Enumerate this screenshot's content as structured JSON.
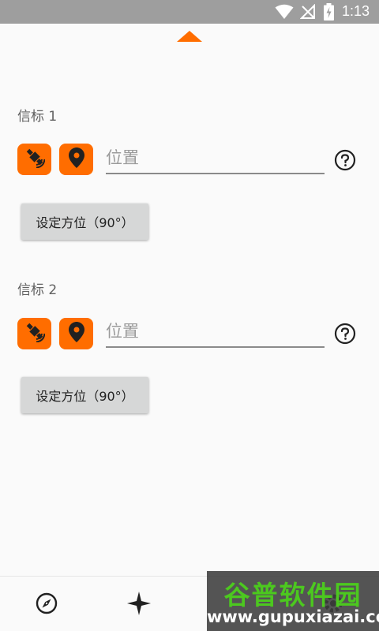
{
  "status_bar": {
    "time": "1:13",
    "icons": [
      "wifi-icon",
      "no-sim-icon",
      "battery-charging-icon"
    ]
  },
  "beacons": [
    {
      "title": "信标 1",
      "location_placeholder": "位置",
      "location_value": "",
      "set_bearing_label": "设定方位（90°）"
    },
    {
      "title": "信标 2",
      "location_placeholder": "位置",
      "location_value": "",
      "set_bearing_label": "设定方位（90°）"
    }
  ],
  "icons": {
    "satellite": "satellite-icon",
    "pin": "location-pin-icon",
    "help": "help-icon",
    "collapse": "collapse-arrow-icon"
  },
  "bottom_nav": {
    "items": [
      "compass-icon",
      "navigate-icon",
      "settings-icon"
    ]
  },
  "watermark": {
    "title": "谷普软件园",
    "url": "www.gupuxiazai.com"
  },
  "colors": {
    "accent": "#ff6d00",
    "status_bar": "#9e9e9e",
    "background": "#fafafa",
    "button_bg": "#d6d7d7",
    "watermark_green": "#4cc81f"
  }
}
